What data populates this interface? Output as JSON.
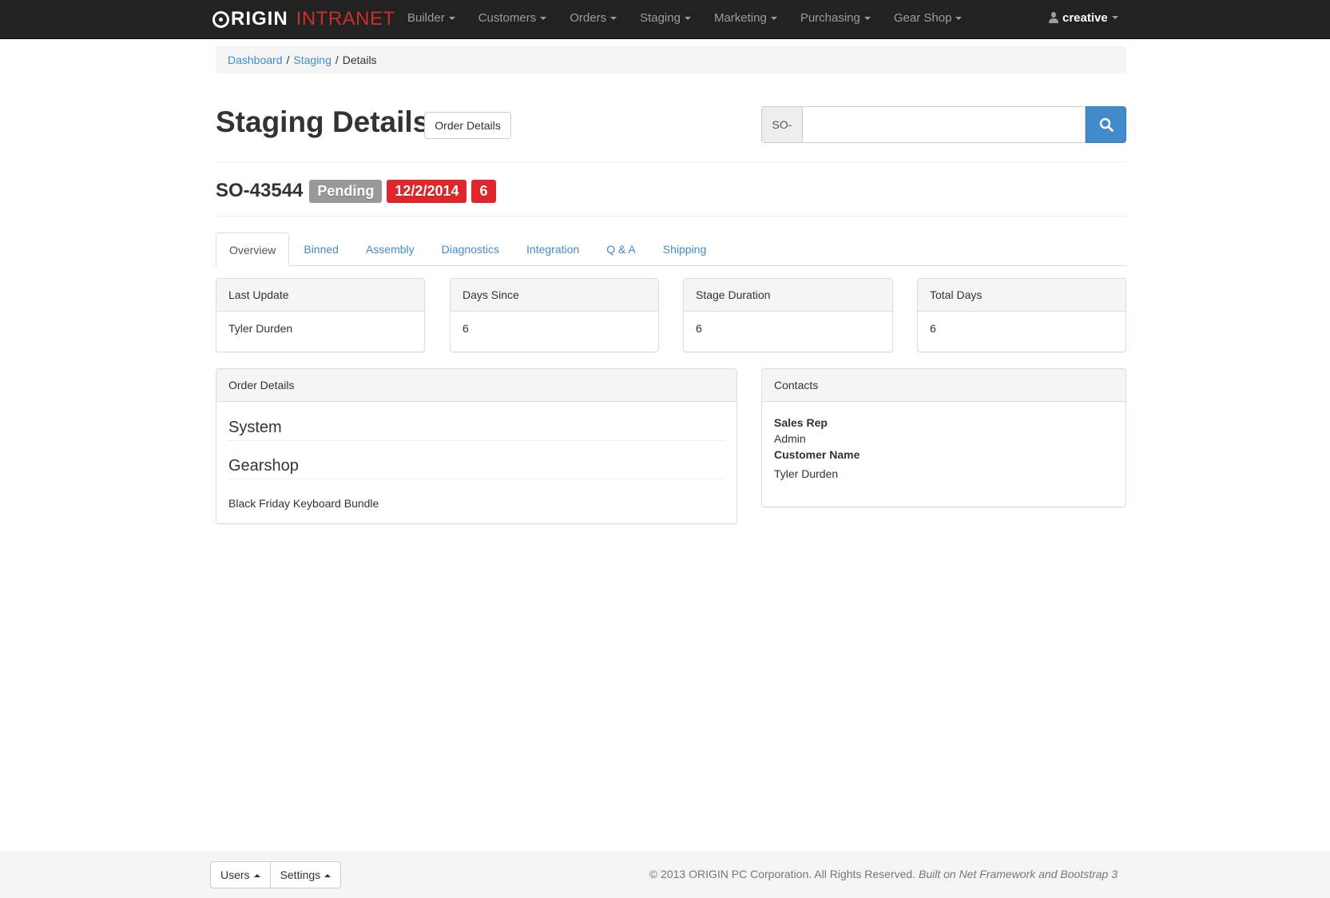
{
  "navbar": {
    "brand_origin": "RIGIN",
    "brand_intranet": "INTRANET",
    "items": [
      {
        "label": "Builder"
      },
      {
        "label": "Customers"
      },
      {
        "label": "Orders"
      },
      {
        "label": "Staging"
      },
      {
        "label": "Marketing"
      },
      {
        "label": "Purchasing"
      },
      {
        "label": "Gear Shop"
      }
    ],
    "user": "creative"
  },
  "breadcrumb": {
    "items": [
      "Dashboard",
      "Staging"
    ],
    "current": "Details",
    "separator": "/"
  },
  "header": {
    "title": "Staging Details",
    "order_details_button": "Order Details",
    "search_prefix": "SO-",
    "search_value": "",
    "search_icon": "search-icon"
  },
  "order": {
    "id": "SO-43544",
    "status": "Pending",
    "date": "12/2/2014",
    "count": "6"
  },
  "tabs": [
    "Overview",
    "Binned",
    "Assembly",
    "Diagnostics",
    "Integration",
    "Q & A",
    "Shipping"
  ],
  "active_tab": "Overview",
  "stats": [
    {
      "title": "Last Update",
      "value": "Tyler Durden"
    },
    {
      "title": "Days Since",
      "value": "6"
    },
    {
      "title": "Stage Duration",
      "value": "6"
    },
    {
      "title": "Total Days",
      "value": "6"
    }
  ],
  "order_details": {
    "heading": "Order Details",
    "sections": [
      {
        "title": "System"
      },
      {
        "title": "Gearshop"
      }
    ],
    "item": "Black Friday Keyboard Bundle"
  },
  "contacts": {
    "heading": "Contacts",
    "sales_rep_label": "Sales Rep",
    "sales_rep": "Admin",
    "customer_name_label": "Customer Name",
    "customer_name": "Tyler Durden"
  },
  "footer": {
    "users_button": "Users",
    "settings_button": "Settings",
    "copyright": "© 2013 ORIGIN PC Corporation. All Rights Reserved.",
    "built_on": "Built on Net Framework and Bootstrap 3"
  },
  "colors": {
    "navbar_bg": "#222222",
    "brand_accent": "#c9302c",
    "link": "#428bca",
    "label_default": "#999999",
    "label_danger": "#e0262a",
    "primary_button": "#428bca"
  }
}
